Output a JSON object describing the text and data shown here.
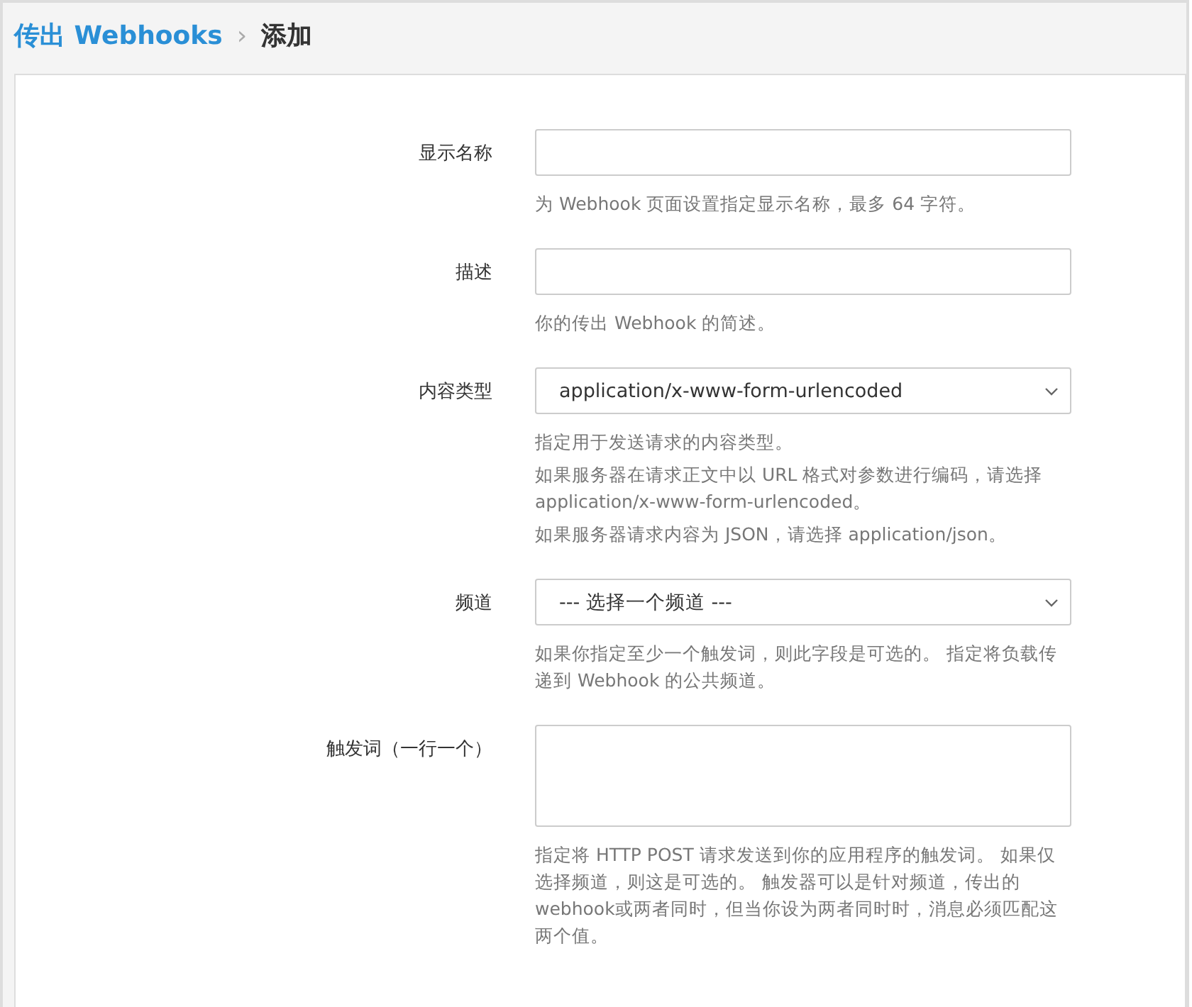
{
  "breadcrumb": {
    "parent": "传出 Webhooks",
    "separator": "›",
    "current": "添加"
  },
  "fields": [
    {
      "kind": "text",
      "label": "显示名称",
      "help": [
        "为 Webhook 页面设置指定显示名称，最多 64 字符。"
      ]
    },
    {
      "kind": "text",
      "label": "描述",
      "help": [
        "你的传出 Webhook 的简述。"
      ]
    },
    {
      "kind": "select",
      "label": "内容类型",
      "value": "application/x-www-form-urlencoded",
      "help": [
        "指定用于发送请求的内容类型。",
        "如果服务器在请求正文中以 URL 格式对参数进行编码，请选择 application/x-www-form-urlencoded。",
        "如果服务器请求内容为 JSON，请选择 application/json。"
      ]
    },
    {
      "kind": "select",
      "label": "频道",
      "value": "--- 选择一个频道 ---",
      "help": [
        "如果你指定至少一个触发词，则此字段是可选的。 指定将负载传递到 Webhook 的公共频道。"
      ]
    },
    {
      "kind": "textarea",
      "label": "触发词（一行一个）",
      "help": [
        "指定将 HTTP POST 请求发送到你的应用程序的触发词。 如果仅选择频道，则这是可选的。 触发器可以是针对频道，传出的 webhook或两者同时，但当你设为两者同时时，消息必须匹配这两个值。"
      ]
    }
  ]
}
